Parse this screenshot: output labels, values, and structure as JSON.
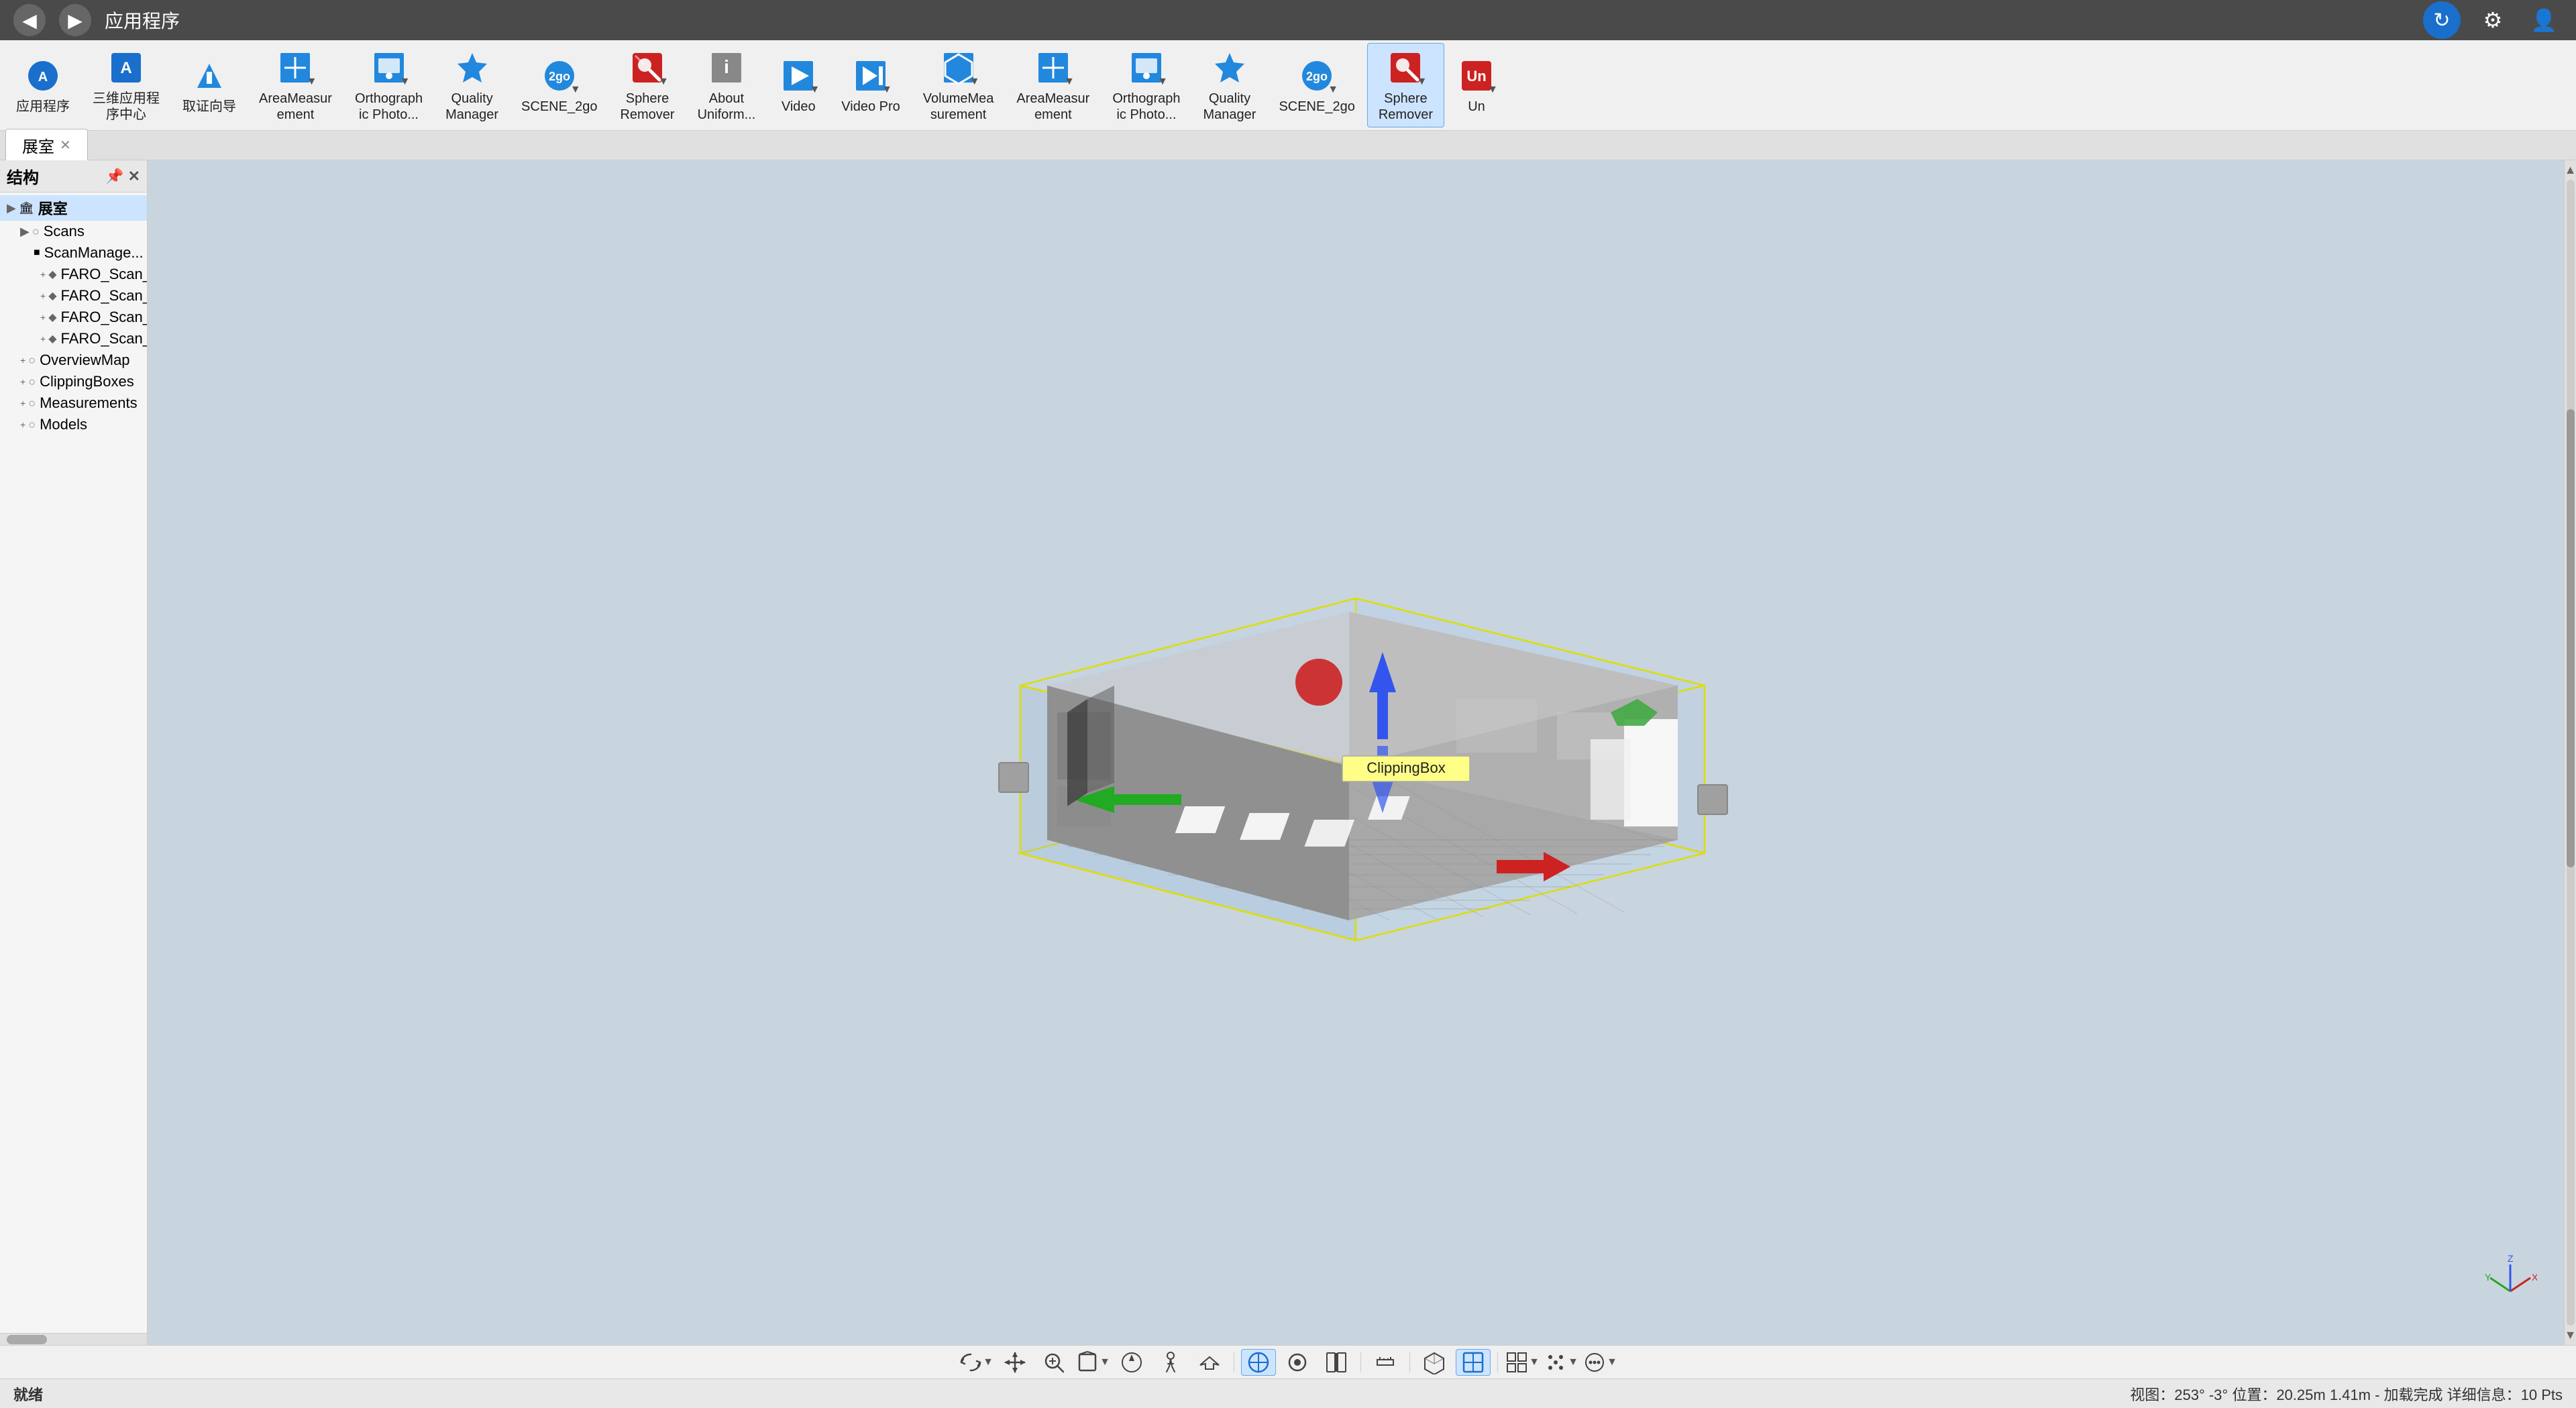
{
  "titlebar": {
    "back_label": "◀",
    "forward_label": "▶",
    "title": "应用程序"
  },
  "toolbar": {
    "items_left": [
      {
        "id": "app",
        "label": "应用程序",
        "icon": "app-icon"
      },
      {
        "id": "3d-center",
        "label": "三维应用程\n序中心",
        "icon": "3d-icon"
      },
      {
        "id": "guide",
        "label": "取证向导",
        "icon": "guide-icon"
      },
      {
        "id": "area-measure",
        "label": "AreaMeasur\nement",
        "icon": "area-icon",
        "has_arrow": true
      },
      {
        "id": "ortho-photo",
        "label": "Orthograph\nic Photo...",
        "icon": "ortho-icon",
        "has_arrow": true
      },
      {
        "id": "quality-mgr",
        "label": "Quality\nManager",
        "icon": "quality-icon"
      },
      {
        "id": "scene2go",
        "label": "SCENE_2go",
        "icon": "scene2go-icon",
        "has_arrow": true
      },
      {
        "id": "sphere-remover",
        "label": "Sphere\nRemover",
        "icon": "sphere-icon",
        "has_arrow": true
      },
      {
        "id": "about-uniform",
        "label": "About\nUniform...",
        "icon": "about-icon"
      },
      {
        "id": "video",
        "label": "Video",
        "icon": "video-icon",
        "has_arrow": true
      },
      {
        "id": "video-pro",
        "label": "Video Pro",
        "icon": "videopro-icon",
        "has_arrow": true
      },
      {
        "id": "volume-meas",
        "label": "VolumeMea\nsurement",
        "icon": "volume-icon",
        "has_arrow": true
      },
      {
        "id": "area-measure2",
        "label": "AreaMeasur\nement",
        "icon": "area-icon2",
        "has_arrow": true
      },
      {
        "id": "ortho-photo2",
        "label": "Orthograph\nic Photo...",
        "icon": "ortho-icon2",
        "has_arrow": true
      },
      {
        "id": "quality-mgr2",
        "label": "Quality\nManager",
        "icon": "quality-icon2"
      },
      {
        "id": "scene2go2",
        "label": "SCENE_2go",
        "icon": "scene2go-icon2",
        "has_arrow": true
      },
      {
        "id": "sphere-remover2",
        "label": "Sphere\nRemover",
        "icon": "sphere-icon2",
        "has_arrow": true
      },
      {
        "id": "un",
        "label": "Un",
        "icon": "un-icon",
        "has_arrow": true
      }
    ]
  },
  "sidebar": {
    "title": "结构",
    "items": [
      {
        "label": "展室",
        "level": 0,
        "expanded": true,
        "bold": true
      },
      {
        "label": "Scans",
        "level": 1,
        "expanded": true
      },
      {
        "label": "ScanManage...",
        "level": 2
      },
      {
        "label": "FARO_Scan_...",
        "level": 3
      },
      {
        "label": "FARO_Scan_...",
        "level": 3
      },
      {
        "label": "FARO_Scan_...",
        "level": 3
      },
      {
        "label": "FARO_Scan_...",
        "level": 3
      },
      {
        "label": "OverviewMap",
        "level": 1
      },
      {
        "label": "ClippingBoxes",
        "level": 1
      },
      {
        "label": "Measurements",
        "level": 1
      },
      {
        "label": "Models",
        "level": 1
      }
    ]
  },
  "tabs": [
    {
      "label": "展室",
      "active": true,
      "closeable": true
    }
  ],
  "viewport": {
    "clipping_label": "ClippingBox"
  },
  "bottom_toolbar": {
    "items": [
      {
        "id": "rotate",
        "icon": "rotate-icon",
        "active": false,
        "has_arrow": true
      },
      {
        "id": "pan",
        "icon": "pan-icon",
        "active": false
      },
      {
        "id": "zoom",
        "icon": "zoom-icon",
        "active": false
      },
      {
        "id": "clip-box",
        "icon": "clip-box-icon",
        "active": false,
        "has_arrow": true
      },
      {
        "id": "navigate",
        "icon": "navigate-icon",
        "active": false
      },
      {
        "id": "walk",
        "icon": "walk-icon",
        "active": false
      },
      {
        "id": "fly",
        "icon": "fly-icon",
        "active": false
      },
      {
        "sep": true
      },
      {
        "id": "select1",
        "icon": "select1-icon",
        "active": true
      },
      {
        "id": "select2",
        "icon": "select2-icon",
        "active": false
      },
      {
        "id": "split",
        "icon": "split-icon",
        "active": false
      },
      {
        "sep": true
      },
      {
        "id": "measure",
        "icon": "measure-icon",
        "active": false
      },
      {
        "sep": true
      },
      {
        "id": "cube",
        "icon": "cube-icon",
        "active": false
      },
      {
        "id": "view-toggle",
        "icon": "view-toggle-icon",
        "active": true
      },
      {
        "sep": true
      },
      {
        "id": "grid",
        "icon": "grid-icon",
        "active": false,
        "has_arrow": true
      },
      {
        "id": "points",
        "icon": "points-icon",
        "active": false,
        "has_arrow": true
      },
      {
        "id": "more",
        "icon": "more-icon",
        "active": false,
        "has_arrow": true
      }
    ]
  },
  "statusbar": {
    "left": "就绪",
    "right": "视图：253° -3° 位置：20.25m 1.41m - 加载完成    详细信息：10 Pts"
  }
}
